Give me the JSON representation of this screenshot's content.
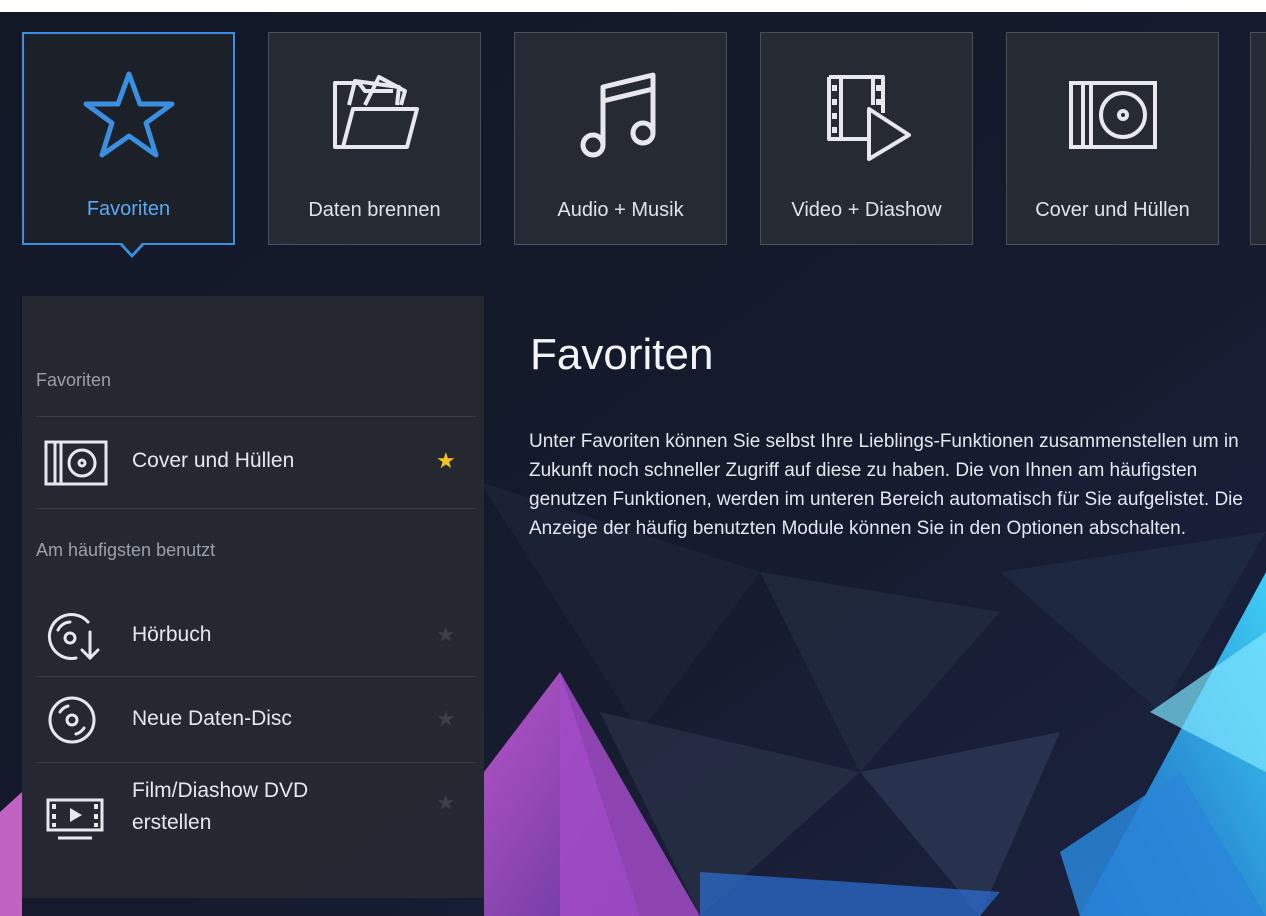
{
  "tiles": [
    {
      "label": "Favoriten",
      "icon": "star-icon",
      "active": true
    },
    {
      "label": "Daten brennen",
      "icon": "folder-icon",
      "active": false
    },
    {
      "label": "Audio + Musik",
      "icon": "music-note-icon",
      "active": false
    },
    {
      "label": "Video + Diashow",
      "icon": "film-play-icon",
      "active": false
    },
    {
      "label": "Cover und Hüllen",
      "icon": "cover-disc-icon",
      "active": false
    }
  ],
  "panel": {
    "favorites_heading": "Favoriten",
    "favorites": [
      {
        "label": "Cover und Hüllen",
        "icon": "cover-disc-icon",
        "favorite": true
      }
    ],
    "most_used_heading": "Am häufigsten benutzt",
    "most_used": [
      {
        "label": "Hörbuch",
        "icon": "audiobook-disc-icon",
        "favorite": false
      },
      {
        "label": "Neue Daten-Disc",
        "icon": "data-disc-icon",
        "favorite": false
      },
      {
        "label": "Film/Diashow DVD",
        "label_line2": "erstellen",
        "icon": "dvd-video-icon",
        "favorite": false
      }
    ]
  },
  "content": {
    "title": "Favoriten",
    "description": "Unter Favoriten können Sie selbst Ihre Lieblings-Funktionen zusammenstellen um in Zukunft noch schneller Zugriff auf diese zu haben. Die von Ihnen am häufigsten genutzen Funktionen, werden im unteren Bereich automatisch für Sie aufgelistet. Die Anzeige der häufig benutzten Module können Sie in den Optionen abschalten."
  },
  "colors": {
    "accent": "#3b8fe0",
    "favorite_star": "#f5c518",
    "tile_bg": "#262a33",
    "panel_bg": "#262832"
  }
}
